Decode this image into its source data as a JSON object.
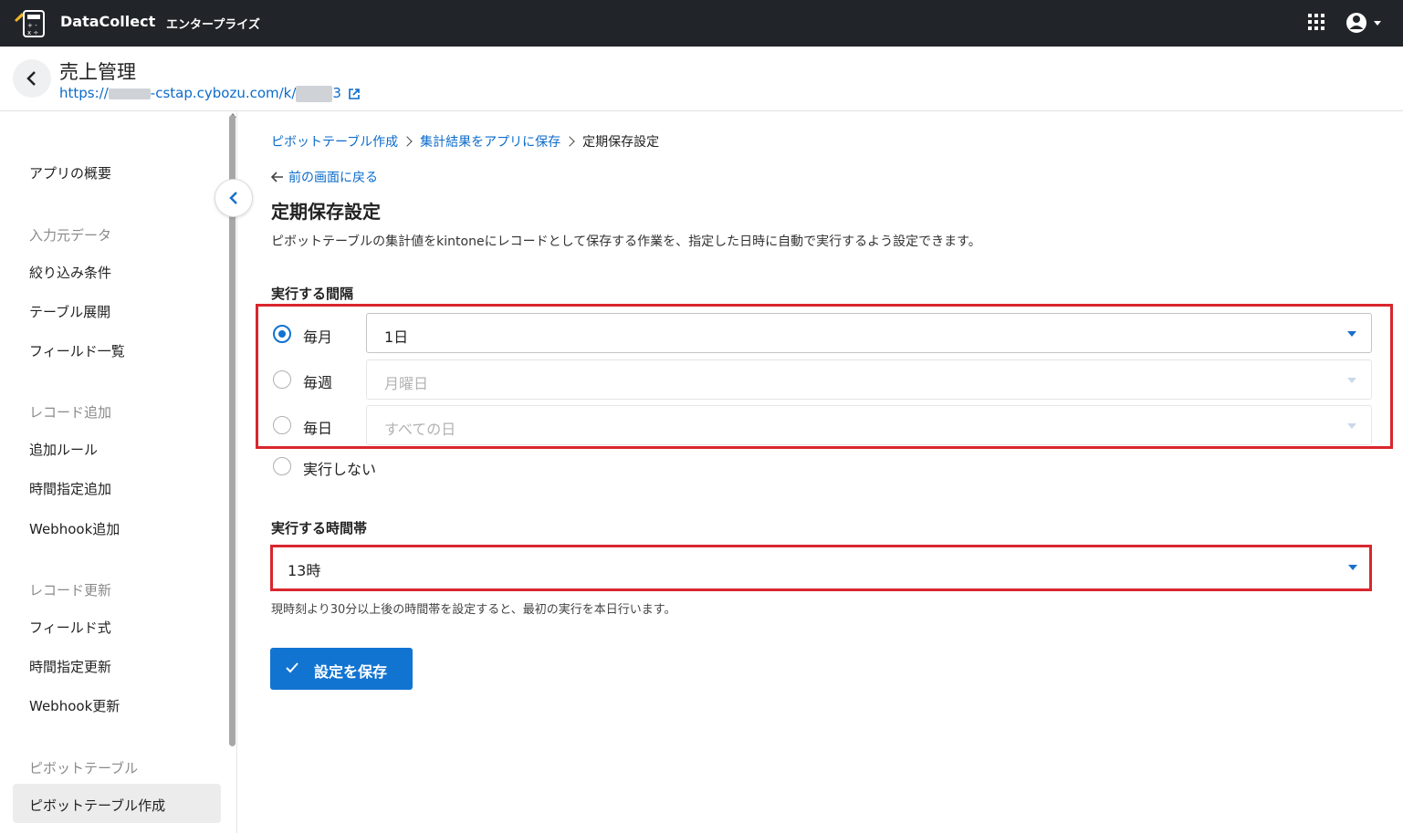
{
  "header": {
    "brand": "DataCollect",
    "edition": "エンタープライズ"
  },
  "app": {
    "title": "売上管理",
    "url_prefix": "https://",
    "url_middle": "-cstap.cybozu.com/k/",
    "url_suffix": "3"
  },
  "sidebar": {
    "overview": "アプリの概要",
    "sections": [
      {
        "title": "入力元データ",
        "items": [
          "絞り込み条件",
          "テーブル展開",
          "フィールド一覧"
        ]
      },
      {
        "title": "レコード追加",
        "items": [
          "追加ルール",
          "時間指定追加",
          "Webhook追加"
        ]
      },
      {
        "title": "レコード更新",
        "items": [
          "フィールド式",
          "時間指定更新",
          "Webhook更新"
        ]
      },
      {
        "title": "ピボットテーブル",
        "items": [
          "ピボットテーブル作成"
        ]
      }
    ],
    "active_item": "ピボットテーブル作成"
  },
  "breadcrumb": {
    "items": [
      "ピボットテーブル作成",
      "集計結果をアプリに保存",
      "定期保存設定"
    ]
  },
  "back_link": "前の画面に戻る",
  "page": {
    "title": "定期保存設定",
    "description": "ピボットテーブルの集計値をkintoneにレコードとして保存する作業を、指定した日時に自動で実行するよう設定できます。"
  },
  "interval": {
    "label": "実行する間隔",
    "options": [
      {
        "label": "毎月",
        "selected": true,
        "select_value": "1日",
        "enabled": true
      },
      {
        "label": "毎週",
        "selected": false,
        "select_value": "月曜日",
        "enabled": false
      },
      {
        "label": "毎日",
        "selected": false,
        "select_value": "すべての日",
        "enabled": false
      },
      {
        "label": "実行しない",
        "selected": false
      }
    ]
  },
  "time_slot": {
    "label": "実行する時間帯",
    "value": "13時",
    "hint": "現時刻より30分以上後の時間帯を設定すると、最初の実行を本日行います。"
  },
  "save_button": "設定を保存",
  "colors": {
    "topbar": "#212529",
    "accent": "#1274d1",
    "link": "#0b6bcb",
    "highlight": "#d9262e"
  },
  "icons": [
    "datacollect-logo-icon",
    "apps-grid-icon",
    "account-icon",
    "chevron-left-icon",
    "external-link-icon",
    "arrow-left-icon",
    "check-icon",
    "caret-down-icon"
  ]
}
